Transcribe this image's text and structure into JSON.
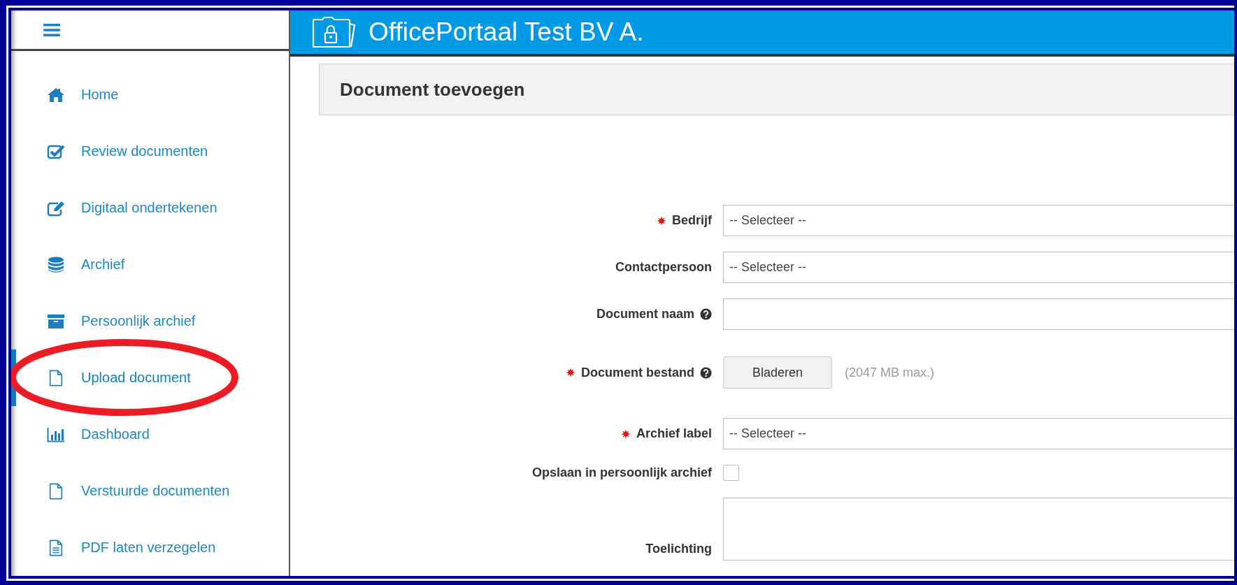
{
  "header": {
    "title": "OfficePortaal Test BV A."
  },
  "sidebar": {
    "items": [
      {
        "kind": "home",
        "label": "Home",
        "selected": false,
        "circled": false
      },
      {
        "kind": "check",
        "label": "Review documenten",
        "selected": false,
        "circled": false
      },
      {
        "kind": "edit",
        "label": "Digitaal ondertekenen",
        "selected": false,
        "circled": false
      },
      {
        "kind": "database",
        "label": "Archief",
        "selected": false,
        "circled": false
      },
      {
        "kind": "archive",
        "label": "Persoonlijk archief",
        "selected": false,
        "circled": false
      },
      {
        "kind": "file",
        "label": "Upload document",
        "selected": true,
        "circled": true
      },
      {
        "kind": "chart",
        "label": "Dashboard",
        "selected": false,
        "circled": false
      },
      {
        "kind": "file",
        "label": "Verstuurde documenten",
        "selected": false,
        "circled": false
      },
      {
        "kind": "file-text",
        "label": "PDF laten verzegelen",
        "selected": false,
        "circled": false
      }
    ]
  },
  "form": {
    "title": "Document toevoegen",
    "fields": [
      {
        "kind": "select",
        "label": "Bedrijf",
        "required": true,
        "help": false,
        "value": "-- Selecteer --"
      },
      {
        "kind": "select",
        "label": "Contactpersoon",
        "required": false,
        "help": false,
        "value": "-- Selecteer --"
      },
      {
        "kind": "text",
        "label": "Document naam",
        "required": false,
        "help": true
      },
      {
        "kind": "file",
        "label": "Document bestand",
        "required": true,
        "help": true,
        "button": "Bladeren",
        "hint": "(2047 MB max.)"
      },
      {
        "kind": "select",
        "label": "Archief label",
        "required": true,
        "help": false,
        "value": "-- Selecteer --"
      },
      {
        "kind": "checkbox",
        "label": "Opslaan in persoonlijk archief",
        "required": false,
        "help": false,
        "checked": false
      },
      {
        "kind": "textarea",
        "label": "Toelichting",
        "required": false,
        "help": false
      }
    ]
  }
}
